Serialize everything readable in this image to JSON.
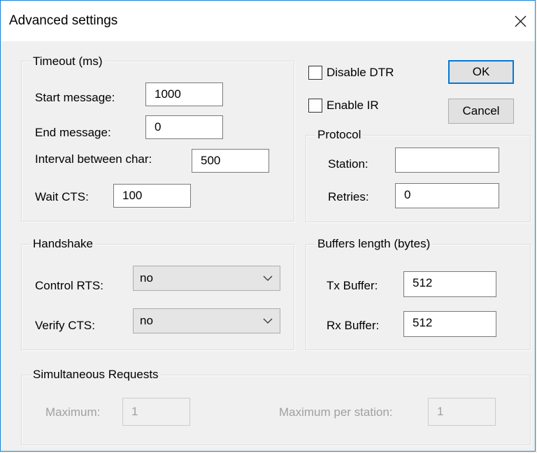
{
  "window": {
    "title": "Advanced settings"
  },
  "buttons": {
    "ok": "OK",
    "cancel": "Cancel"
  },
  "timeout": {
    "legend": "Timeout (ms)",
    "start_message": {
      "label": "Start message:",
      "value": "1000"
    },
    "end_message": {
      "label": "End message:",
      "value": "0"
    },
    "interval_between_char": {
      "label": "Interval between char:",
      "value": "500"
    },
    "wait_cts": {
      "label": "Wait CTS:",
      "value": "100"
    }
  },
  "options": {
    "disable_dtr": {
      "label": "Disable DTR",
      "checked": false
    },
    "enable_ir": {
      "label": "Enable IR",
      "checked": false
    }
  },
  "protocol": {
    "legend": "Protocol",
    "station": {
      "label": "Station:",
      "value": ""
    },
    "retries": {
      "label": "Retries:",
      "value": "0"
    }
  },
  "handshake": {
    "legend": "Handshake",
    "control_rts": {
      "label": "Control RTS:",
      "value": "no"
    },
    "verify_cts": {
      "label": "Verify CTS:",
      "value": "no"
    }
  },
  "buffers": {
    "legend": "Buffers length (bytes)",
    "tx": {
      "label": "Tx Buffer:",
      "value": "512"
    },
    "rx": {
      "label": "Rx Buffer:",
      "value": "512"
    }
  },
  "simultaneous": {
    "legend": "Simultaneous Requests",
    "maximum": {
      "label": "Maximum:",
      "value": "1"
    },
    "maximum_per_station": {
      "label": "Maximum per station:",
      "value": "1"
    }
  },
  "icons": {
    "close": "close-icon",
    "dropdown": "chevron-down-icon"
  },
  "colors": {
    "window_border": "#1883d7",
    "default_button_border": "#0078d7",
    "disabled_text": "#a0a0a0"
  }
}
